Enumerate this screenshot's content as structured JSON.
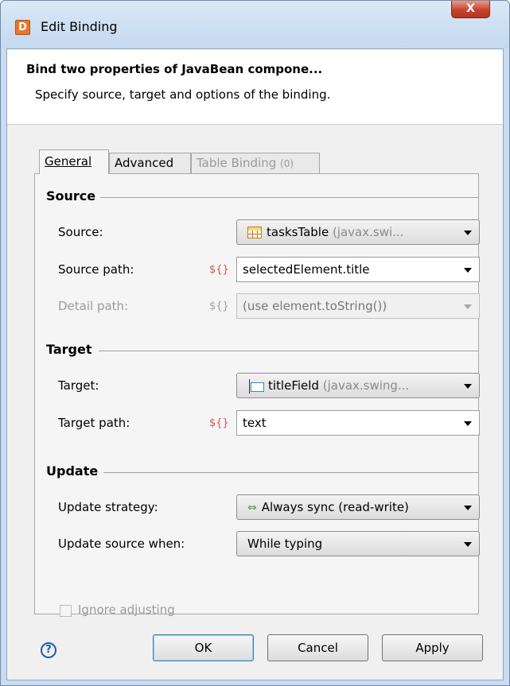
{
  "window": {
    "title": "Edit Binding",
    "app_icon_letter": "D",
    "close_glyph": "X"
  },
  "header": {
    "title": "Bind two properties of JavaBean compone...",
    "description": "Specify source, target and options of the binding."
  },
  "tabs": [
    {
      "label": "General",
      "active": true
    },
    {
      "label": "Advanced",
      "active": false
    },
    {
      "label": "Table Binding",
      "count": "(0)",
      "disabled": true
    }
  ],
  "source": {
    "section_title": "Source",
    "source_label": "Source:",
    "source_value": "tasksTable",
    "source_type": "(javax.swi...",
    "source_icon": "table-icon",
    "path_label": "Source path:",
    "path_expr": "${}",
    "path_value": "selectedElement.title",
    "detail_label": "Detail path:",
    "detail_expr": "${}",
    "detail_value": "(use element.toString())"
  },
  "target": {
    "section_title": "Target",
    "target_label": "Target:",
    "target_value": "titleField",
    "target_type": "(javax.swing...",
    "target_icon": "textfield-icon",
    "path_label": "Target path:",
    "path_expr": "${}",
    "path_value": "text"
  },
  "update": {
    "section_title": "Update",
    "strategy_label": "Update strategy:",
    "strategy_value": "Always sync (read-write)",
    "strategy_icon": "sync-arrows-icon",
    "when_label": "Update source when:",
    "when_value": "While typing",
    "ignore_label": "Ignore adjusting",
    "ignore_checked": false
  },
  "buttons": {
    "help": "?",
    "ok": "OK",
    "cancel": "Cancel",
    "apply": "Apply"
  },
  "colors": {
    "expr_red": "#d9534f",
    "title_bg": "#c4d8ef",
    "close_red": "#c7432d"
  }
}
